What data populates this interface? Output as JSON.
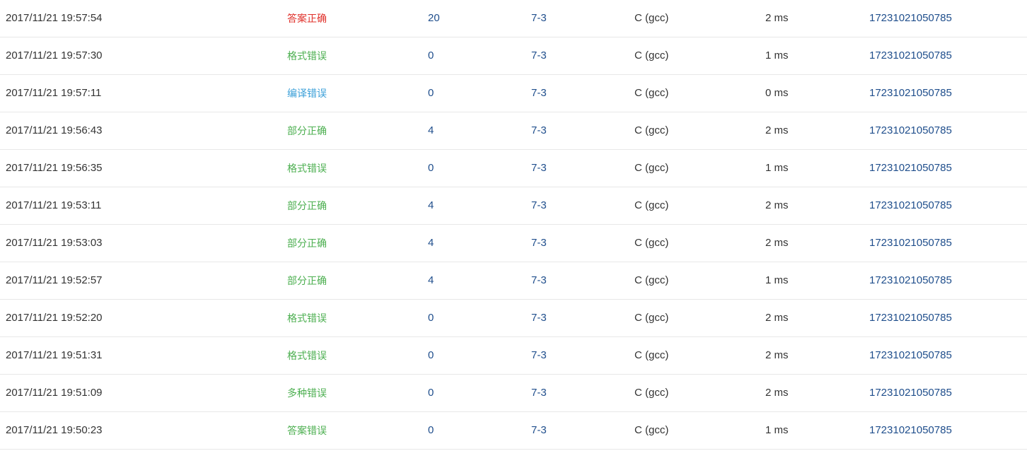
{
  "colors": {
    "accepted": "#e0302a",
    "compile_error": "#3a9fd8",
    "other": "#4caf50",
    "link": "#1f4e8c"
  },
  "rows": [
    {
      "time": "2017/11/21 19:57:54",
      "status": "答案正确",
      "status_kind": "accepted",
      "score": "20",
      "problem": "7-3",
      "compiler": "C (gcc)",
      "duration": "2 ms",
      "id": "17231021050785"
    },
    {
      "time": "2017/11/21 19:57:30",
      "status": "格式错误",
      "status_kind": "other",
      "score": "0",
      "problem": "7-3",
      "compiler": "C (gcc)",
      "duration": "1 ms",
      "id": "17231021050785"
    },
    {
      "time": "2017/11/21 19:57:11",
      "status": "编译错误",
      "status_kind": "compile_error",
      "score": "0",
      "problem": "7-3",
      "compiler": "C (gcc)",
      "duration": "0 ms",
      "id": "17231021050785"
    },
    {
      "time": "2017/11/21 19:56:43",
      "status": "部分正确",
      "status_kind": "other",
      "score": "4",
      "problem": "7-3",
      "compiler": "C (gcc)",
      "duration": "2 ms",
      "id": "17231021050785"
    },
    {
      "time": "2017/11/21 19:56:35",
      "status": "格式错误",
      "status_kind": "other",
      "score": "0",
      "problem": "7-3",
      "compiler": "C (gcc)",
      "duration": "1 ms",
      "id": "17231021050785"
    },
    {
      "time": "2017/11/21 19:53:11",
      "status": "部分正确",
      "status_kind": "other",
      "score": "4",
      "problem": "7-3",
      "compiler": "C (gcc)",
      "duration": "2 ms",
      "id": "17231021050785"
    },
    {
      "time": "2017/11/21 19:53:03",
      "status": "部分正确",
      "status_kind": "other",
      "score": "4",
      "problem": "7-3",
      "compiler": "C (gcc)",
      "duration": "2 ms",
      "id": "17231021050785"
    },
    {
      "time": "2017/11/21 19:52:57",
      "status": "部分正确",
      "status_kind": "other",
      "score": "4",
      "problem": "7-3",
      "compiler": "C (gcc)",
      "duration": "1 ms",
      "id": "17231021050785"
    },
    {
      "time": "2017/11/21 19:52:20",
      "status": "格式错误",
      "status_kind": "other",
      "score": "0",
      "problem": "7-3",
      "compiler": "C (gcc)",
      "duration": "2 ms",
      "id": "17231021050785"
    },
    {
      "time": "2017/11/21 19:51:31",
      "status": "格式错误",
      "status_kind": "other",
      "score": "0",
      "problem": "7-3",
      "compiler": "C (gcc)",
      "duration": "2 ms",
      "id": "17231021050785"
    },
    {
      "time": "2017/11/21 19:51:09",
      "status": "多种错误",
      "status_kind": "other",
      "score": "0",
      "problem": "7-3",
      "compiler": "C (gcc)",
      "duration": "2 ms",
      "id": "17231021050785"
    },
    {
      "time": "2017/11/21 19:50:23",
      "status": "答案错误",
      "status_kind": "other",
      "score": "0",
      "problem": "7-3",
      "compiler": "C (gcc)",
      "duration": "1 ms",
      "id": "17231021050785"
    }
  ]
}
